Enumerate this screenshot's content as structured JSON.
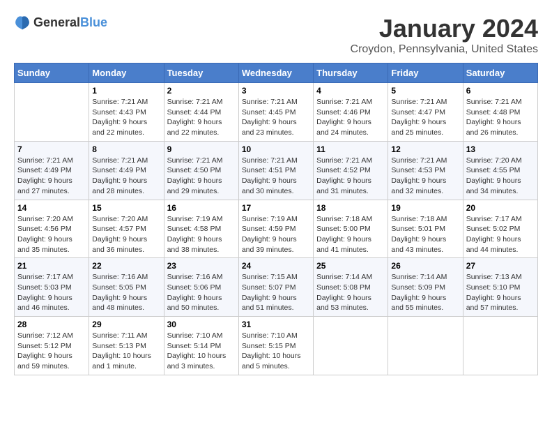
{
  "header": {
    "logo_general": "General",
    "logo_blue": "Blue",
    "month": "January 2024",
    "location": "Croydon, Pennsylvania, United States"
  },
  "days_of_week": [
    "Sunday",
    "Monday",
    "Tuesday",
    "Wednesday",
    "Thursday",
    "Friday",
    "Saturday"
  ],
  "weeks": [
    [
      {
        "day": "",
        "empty": true
      },
      {
        "day": "1",
        "sunrise": "7:21 AM",
        "sunset": "4:43 PM",
        "daylight": "9 hours and 22 minutes."
      },
      {
        "day": "2",
        "sunrise": "7:21 AM",
        "sunset": "4:44 PM",
        "daylight": "9 hours and 22 minutes."
      },
      {
        "day": "3",
        "sunrise": "7:21 AM",
        "sunset": "4:45 PM",
        "daylight": "9 hours and 23 minutes."
      },
      {
        "day": "4",
        "sunrise": "7:21 AM",
        "sunset": "4:46 PM",
        "daylight": "9 hours and 24 minutes."
      },
      {
        "day": "5",
        "sunrise": "7:21 AM",
        "sunset": "4:47 PM",
        "daylight": "9 hours and 25 minutes."
      },
      {
        "day": "6",
        "sunrise": "7:21 AM",
        "sunset": "4:48 PM",
        "daylight": "9 hours and 26 minutes."
      }
    ],
    [
      {
        "day": "7",
        "sunrise": "7:21 AM",
        "sunset": "4:49 PM",
        "daylight": "9 hours and 27 minutes."
      },
      {
        "day": "8",
        "sunrise": "7:21 AM",
        "sunset": "4:49 PM",
        "daylight": "9 hours and 28 minutes."
      },
      {
        "day": "9",
        "sunrise": "7:21 AM",
        "sunset": "4:50 PM",
        "daylight": "9 hours and 29 minutes."
      },
      {
        "day": "10",
        "sunrise": "7:21 AM",
        "sunset": "4:51 PM",
        "daylight": "9 hours and 30 minutes."
      },
      {
        "day": "11",
        "sunrise": "7:21 AM",
        "sunset": "4:52 PM",
        "daylight": "9 hours and 31 minutes."
      },
      {
        "day": "12",
        "sunrise": "7:21 AM",
        "sunset": "4:53 PM",
        "daylight": "9 hours and 32 minutes."
      },
      {
        "day": "13",
        "sunrise": "7:20 AM",
        "sunset": "4:55 PM",
        "daylight": "9 hours and 34 minutes."
      }
    ],
    [
      {
        "day": "14",
        "sunrise": "7:20 AM",
        "sunset": "4:56 PM",
        "daylight": "9 hours and 35 minutes."
      },
      {
        "day": "15",
        "sunrise": "7:20 AM",
        "sunset": "4:57 PM",
        "daylight": "9 hours and 36 minutes."
      },
      {
        "day": "16",
        "sunrise": "7:19 AM",
        "sunset": "4:58 PM",
        "daylight": "9 hours and 38 minutes."
      },
      {
        "day": "17",
        "sunrise": "7:19 AM",
        "sunset": "4:59 PM",
        "daylight": "9 hours and 39 minutes."
      },
      {
        "day": "18",
        "sunrise": "7:18 AM",
        "sunset": "5:00 PM",
        "daylight": "9 hours and 41 minutes."
      },
      {
        "day": "19",
        "sunrise": "7:18 AM",
        "sunset": "5:01 PM",
        "daylight": "9 hours and 43 minutes."
      },
      {
        "day": "20",
        "sunrise": "7:17 AM",
        "sunset": "5:02 PM",
        "daylight": "9 hours and 44 minutes."
      }
    ],
    [
      {
        "day": "21",
        "sunrise": "7:17 AM",
        "sunset": "5:03 PM",
        "daylight": "9 hours and 46 minutes."
      },
      {
        "day": "22",
        "sunrise": "7:16 AM",
        "sunset": "5:05 PM",
        "daylight": "9 hours and 48 minutes."
      },
      {
        "day": "23",
        "sunrise": "7:16 AM",
        "sunset": "5:06 PM",
        "daylight": "9 hours and 50 minutes."
      },
      {
        "day": "24",
        "sunrise": "7:15 AM",
        "sunset": "5:07 PM",
        "daylight": "9 hours and 51 minutes."
      },
      {
        "day": "25",
        "sunrise": "7:14 AM",
        "sunset": "5:08 PM",
        "daylight": "9 hours and 53 minutes."
      },
      {
        "day": "26",
        "sunrise": "7:14 AM",
        "sunset": "5:09 PM",
        "daylight": "9 hours and 55 minutes."
      },
      {
        "day": "27",
        "sunrise": "7:13 AM",
        "sunset": "5:10 PM",
        "daylight": "9 hours and 57 minutes."
      }
    ],
    [
      {
        "day": "28",
        "sunrise": "7:12 AM",
        "sunset": "5:12 PM",
        "daylight": "9 hours and 59 minutes."
      },
      {
        "day": "29",
        "sunrise": "7:11 AM",
        "sunset": "5:13 PM",
        "daylight": "10 hours and 1 minute."
      },
      {
        "day": "30",
        "sunrise": "7:10 AM",
        "sunset": "5:14 PM",
        "daylight": "10 hours and 3 minutes."
      },
      {
        "day": "31",
        "sunrise": "7:10 AM",
        "sunset": "5:15 PM",
        "daylight": "10 hours and 5 minutes."
      },
      {
        "day": "",
        "empty": true
      },
      {
        "day": "",
        "empty": true
      },
      {
        "day": "",
        "empty": true
      }
    ]
  ],
  "labels": {
    "sunrise_prefix": "Sunrise: ",
    "sunset_prefix": "Sunset: ",
    "daylight_prefix": "Daylight: "
  }
}
